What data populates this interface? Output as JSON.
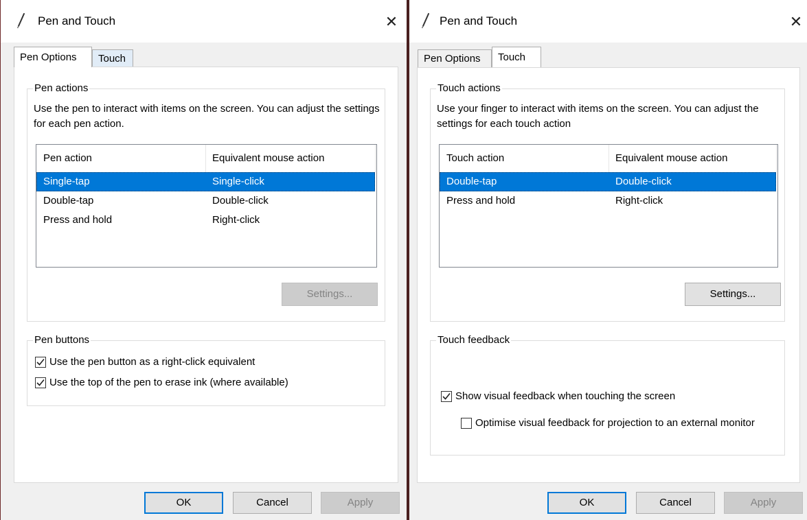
{
  "left_dialog": {
    "title": "Pen and Touch",
    "close_glyph": "✕",
    "tabs": [
      {
        "label": "Pen Options",
        "active": true
      },
      {
        "label": "Touch",
        "active": false
      }
    ],
    "actions_group": {
      "label": "Pen actions",
      "description": "Use the pen to interact with items on the screen. You can adjust the settings for each pen action.",
      "columns": [
        "Pen action",
        "Equivalent mouse action"
      ],
      "rows": [
        {
          "action": "Single-tap",
          "mouse": "Single-click",
          "selected": true
        },
        {
          "action": "Double-tap",
          "mouse": "Double-click",
          "selected": false
        },
        {
          "action": "Press and hold",
          "mouse": "Right-click",
          "selected": false
        }
      ],
      "settings_label": "Settings..."
    },
    "buttons_group": {
      "label": "Pen buttons",
      "options": [
        {
          "label": "Use the pen button as a right-click equivalent",
          "checked": true
        },
        {
          "label": "Use the top of the pen to erase ink (where available)",
          "checked": true
        }
      ]
    },
    "footer": {
      "ok": "OK",
      "cancel": "Cancel",
      "apply": "Apply"
    }
  },
  "right_dialog": {
    "title": "Pen and Touch",
    "close_glyph": "✕",
    "tabs": [
      {
        "label": "Pen Options",
        "active": false
      },
      {
        "label": "Touch",
        "active": true
      }
    ],
    "actions_group": {
      "label": "Touch actions",
      "description": "Use your finger to interact with items on the screen. You can adjust the settings for each touch action",
      "columns": [
        "Touch action",
        "Equivalent mouse action"
      ],
      "rows": [
        {
          "action": "Double-tap",
          "mouse": "Double-click",
          "selected": true
        },
        {
          "action": "Press and hold",
          "mouse": "Right-click",
          "selected": false
        }
      ],
      "settings_label": "Settings..."
    },
    "feedback_group": {
      "label": "Touch feedback",
      "options": [
        {
          "label": "Show visual feedback when touching the screen",
          "checked": true
        },
        {
          "label": "Optimise visual feedback for projection to an external monitor",
          "checked": false
        }
      ]
    },
    "footer": {
      "ok": "OK",
      "cancel": "Cancel",
      "apply": "Apply"
    }
  },
  "colors": {
    "selection": "#0078d7",
    "default_button_border": "#0078d7",
    "window_bg": "#f0f0f0",
    "panel_bg": "#ffffff"
  }
}
